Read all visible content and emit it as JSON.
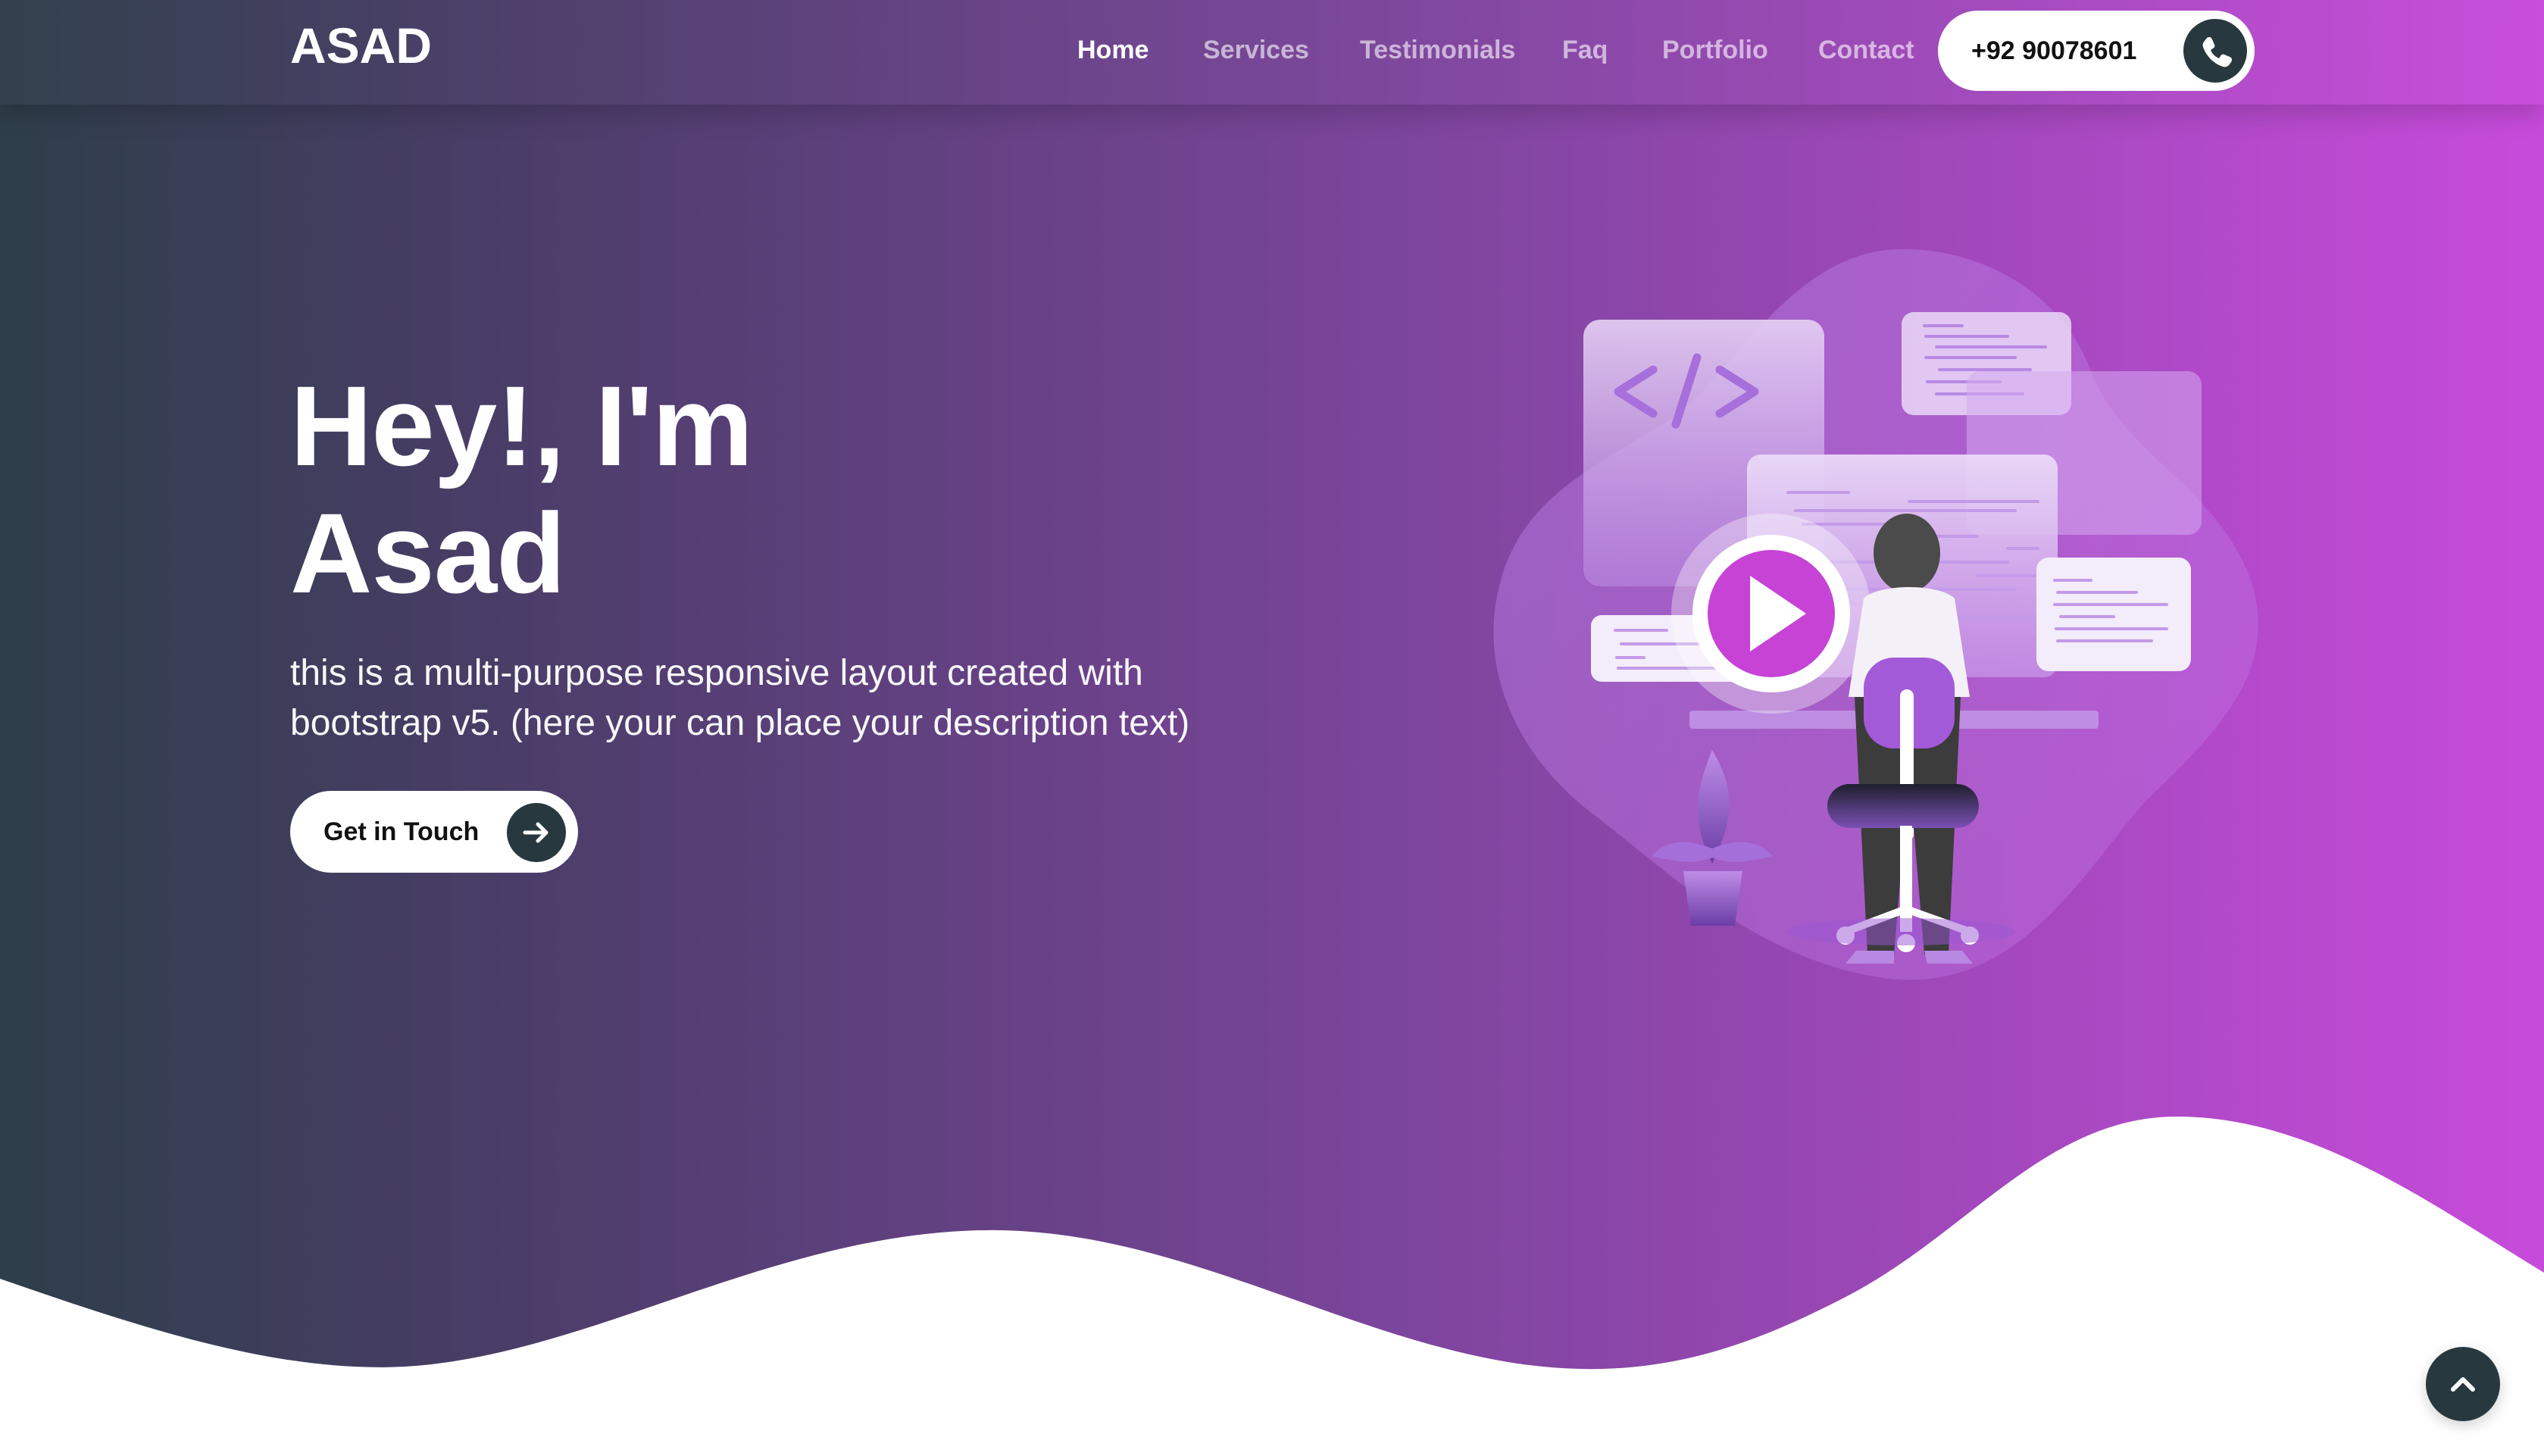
{
  "brand": {
    "name": "ASAD"
  },
  "nav": {
    "items": [
      {
        "label": "Home",
        "active": true
      },
      {
        "label": "Services",
        "active": false
      },
      {
        "label": "Testimonials",
        "active": false
      },
      {
        "label": "Faq",
        "active": false
      },
      {
        "label": "Portfolio",
        "active": false
      },
      {
        "label": "Contact",
        "active": false
      }
    ],
    "phone": "+92 90078601"
  },
  "hero": {
    "title_line1": "Hey!, I'm",
    "title_line2": "Asad",
    "description": "this is a multi-purpose responsive layout created with bootstrap v5. (here your can place your description text)",
    "cta_label": "Get in Touch"
  },
  "icons": {
    "phone": "phone-icon",
    "cta": "arrow-right-icon",
    "scroll_top": "chevron-up-icon",
    "illustration_code": "code-tag-icon",
    "illustration_play": "play-icon"
  },
  "colors": {
    "gradient_start": "#2e3e4a",
    "gradient_mid": "#7c459c",
    "gradient_end": "#c74bdb",
    "dark_button": "#27393f",
    "white": "#ffffff"
  }
}
